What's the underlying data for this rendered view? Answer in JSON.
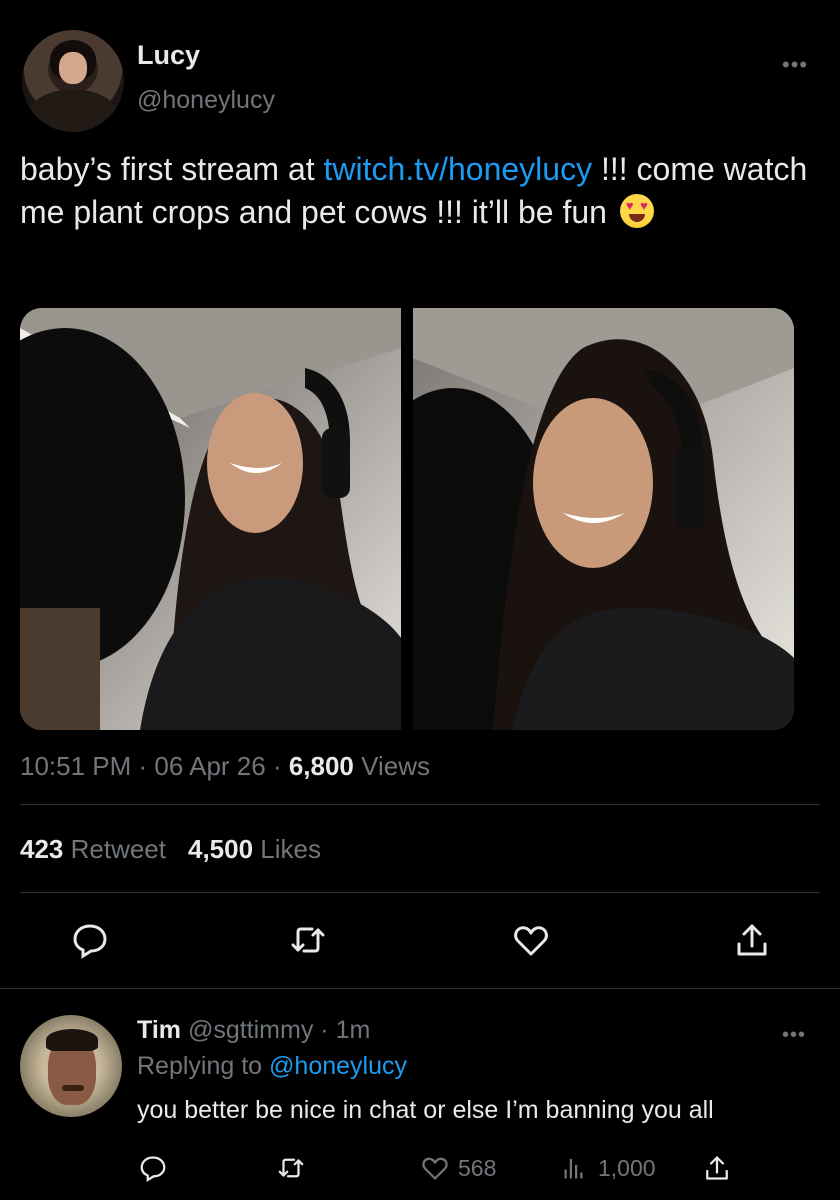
{
  "tweet": {
    "author": {
      "name": "Lucy",
      "handle": "@honeylucy"
    },
    "more_icon": "ellipsis-icon",
    "text": {
      "part1": "baby’s first stream at ",
      "link": "twitch.tv/honeylucy",
      "part2": " !!! come watch me plant crops and pet cows !!! it’ll be fun",
      "emoji": "heart-eyes-emoji"
    },
    "meta": {
      "time": "10:51 PM",
      "sep1": " · ",
      "date": "06 Apr 26",
      "sep2": " · ",
      "views": "6,800",
      "views_label": " Views"
    },
    "stats": {
      "retweets": "423",
      "retweets_label": " Retweet",
      "likes": "4,500",
      "likes_label": " Likes"
    },
    "actions": [
      "reply-icon",
      "retweet-icon",
      "like-icon",
      "share-icon"
    ]
  },
  "reply": {
    "name": "Tim",
    "handle": "@sgttimmy",
    "sep": " · ",
    "time": "1m",
    "replying_prefix": "Replying to ",
    "replying_to": "@honeylucy",
    "text": "you better be nice in chat or else I’m banning you all",
    "actions": {
      "likes": "568",
      "views": "1,000"
    }
  },
  "colors": {
    "background": "#000000",
    "text": "#e7e9ea",
    "muted": "#71767b",
    "link": "#1d9bf0",
    "divider": "#2f3336"
  }
}
